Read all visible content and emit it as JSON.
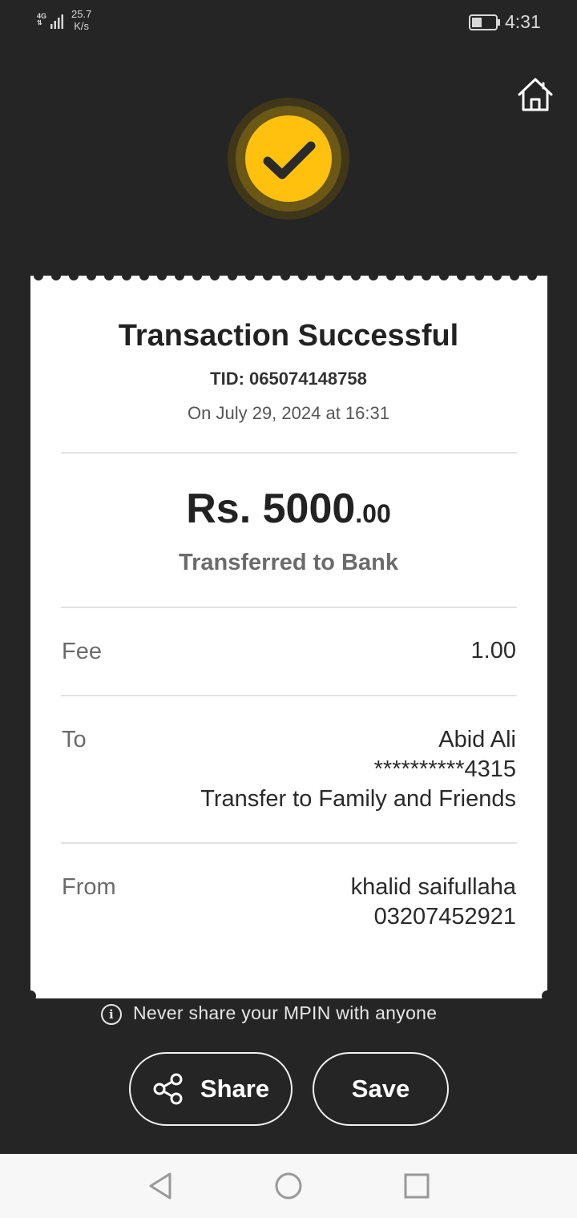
{
  "status_bar": {
    "network": "4G",
    "speed_value": "25.7",
    "speed_unit": "K/s",
    "time": "4:31"
  },
  "receipt": {
    "title": "Transaction Successful",
    "tid": "TID: 065074148758",
    "date": "On July 29, 2024 at 16:31",
    "amount_main": "Rs. 5000",
    "amount_decimal": ".00",
    "transfer_type": "Transferred to Bank",
    "fee": {
      "label": "Fee",
      "value": "1.00"
    },
    "to": {
      "label": "To",
      "name": "Abid Ali",
      "account": "**********4315",
      "description": "Transfer to Family and Friends"
    },
    "from": {
      "label": "From",
      "name": "khalid saifullaha",
      "number": "03207452921"
    }
  },
  "warning": "Never share your MPIN with anyone",
  "actions": {
    "share_label": "Share",
    "save_label": "Save"
  },
  "colors": {
    "background": "#252525",
    "accent": "#ffc10e",
    "card": "#ffffff"
  },
  "icons": [
    "home-icon",
    "checkmark-icon",
    "info-icon",
    "share-icon",
    "back-icon",
    "home-circle-icon",
    "recents-icon"
  ]
}
